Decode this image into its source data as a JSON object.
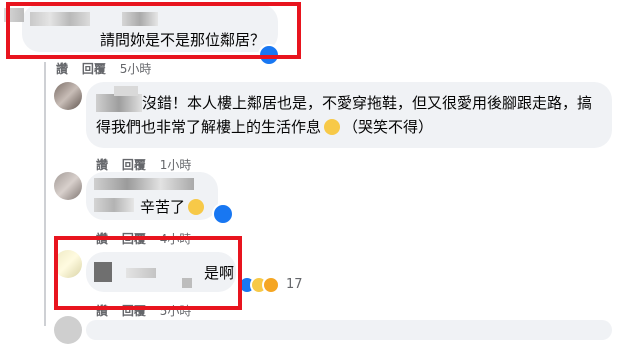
{
  "comments": [
    {
      "text": "請問妳是不是那位鄰居？",
      "actions": {
        "like": "讚",
        "reply": "回覆",
        "time": "5小時"
      }
    },
    {
      "text_line1": "沒錯！本人樓上鄰居也是，不愛穿拖鞋，但又很愛用後腳跟走路，搞",
      "text_line2": "得我們也非常了解樓上的生活作息",
      "text_line2_tail": "（哭笑不得）",
      "actions": {
        "like": "讚",
        "reply": "回覆",
        "time": "1小時"
      }
    },
    {
      "text": "辛苦了",
      "actions": {
        "like": "讚",
        "reply": "回覆",
        "time": "4小時"
      }
    },
    {
      "text": "是啊",
      "reaction_count": "17",
      "actions": {
        "like": "讚",
        "reply": "回覆",
        "time": "5小時"
      }
    }
  ],
  "colors": {
    "highlight": "#e8141e",
    "like_blue": "#1877f2",
    "bubble": "#f0f2f5",
    "meta": "#65676b"
  },
  "icons": [
    "like-reaction-icon",
    "wow-reaction-icon",
    "care-reaction-icon",
    "grin-sweat-emoji-icon",
    "tired-emoji-icon"
  ]
}
